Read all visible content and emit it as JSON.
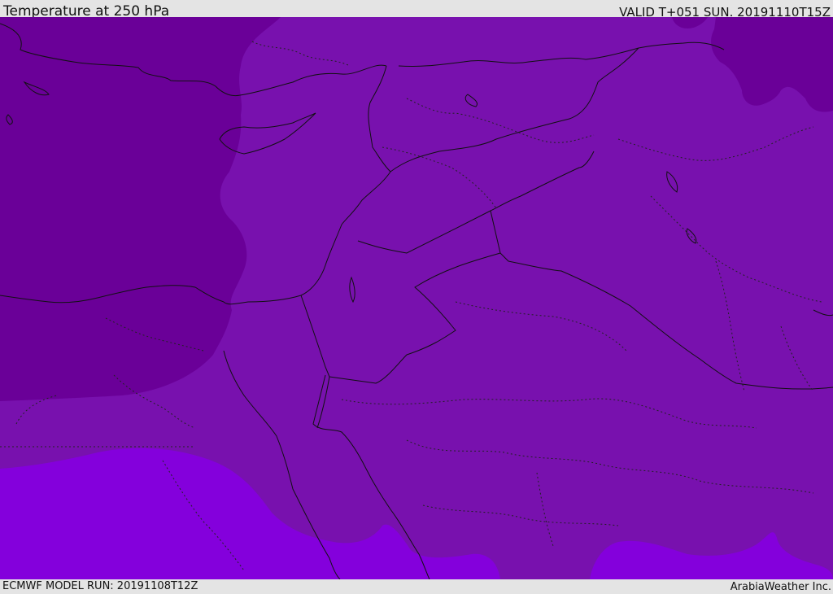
{
  "header": {
    "title": "Temperature at 250 hPa",
    "valid": "VALID T+051 SUN. 20191110T15Z"
  },
  "footer": {
    "model_run": "ECMWF MODEL RUN: 20191108T12Z",
    "credit": "ArabiaWeather Inc."
  },
  "colors": {
    "band_cold": "#6a0098",
    "band_mid": "#7811ae",
    "band_warm": "#8400dc",
    "lines": "#111111",
    "chrome": "#e4e4e4"
  }
}
